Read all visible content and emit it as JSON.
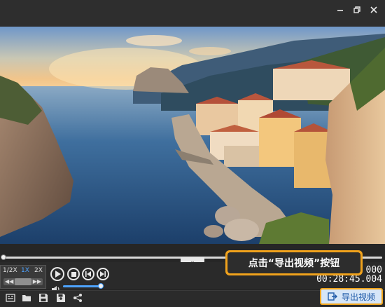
{
  "window": {
    "controls": [
      "minimize-icon",
      "restore-icon",
      "close-icon"
    ]
  },
  "video": {
    "subject": "coastal-village-sunset"
  },
  "playback": {
    "speed_options": [
      "1/2X",
      "1X",
      "2X"
    ],
    "active_speed": "1X",
    "current_time": "000",
    "total_time": "00:28:45.004",
    "volume_level": 0.9,
    "progress": 0.0
  },
  "toolbar": {
    "tools": [
      "subtitle-icon",
      "folder-icon",
      "save-icon",
      "save-as-icon",
      "share-icon"
    ],
    "export_label": "导出视频"
  },
  "callout": {
    "text": "点击“导出视频”按钮"
  },
  "colors": {
    "accent": "#4da3ff",
    "highlight": "#f0a21c",
    "export_text": "#1f5aa8"
  }
}
